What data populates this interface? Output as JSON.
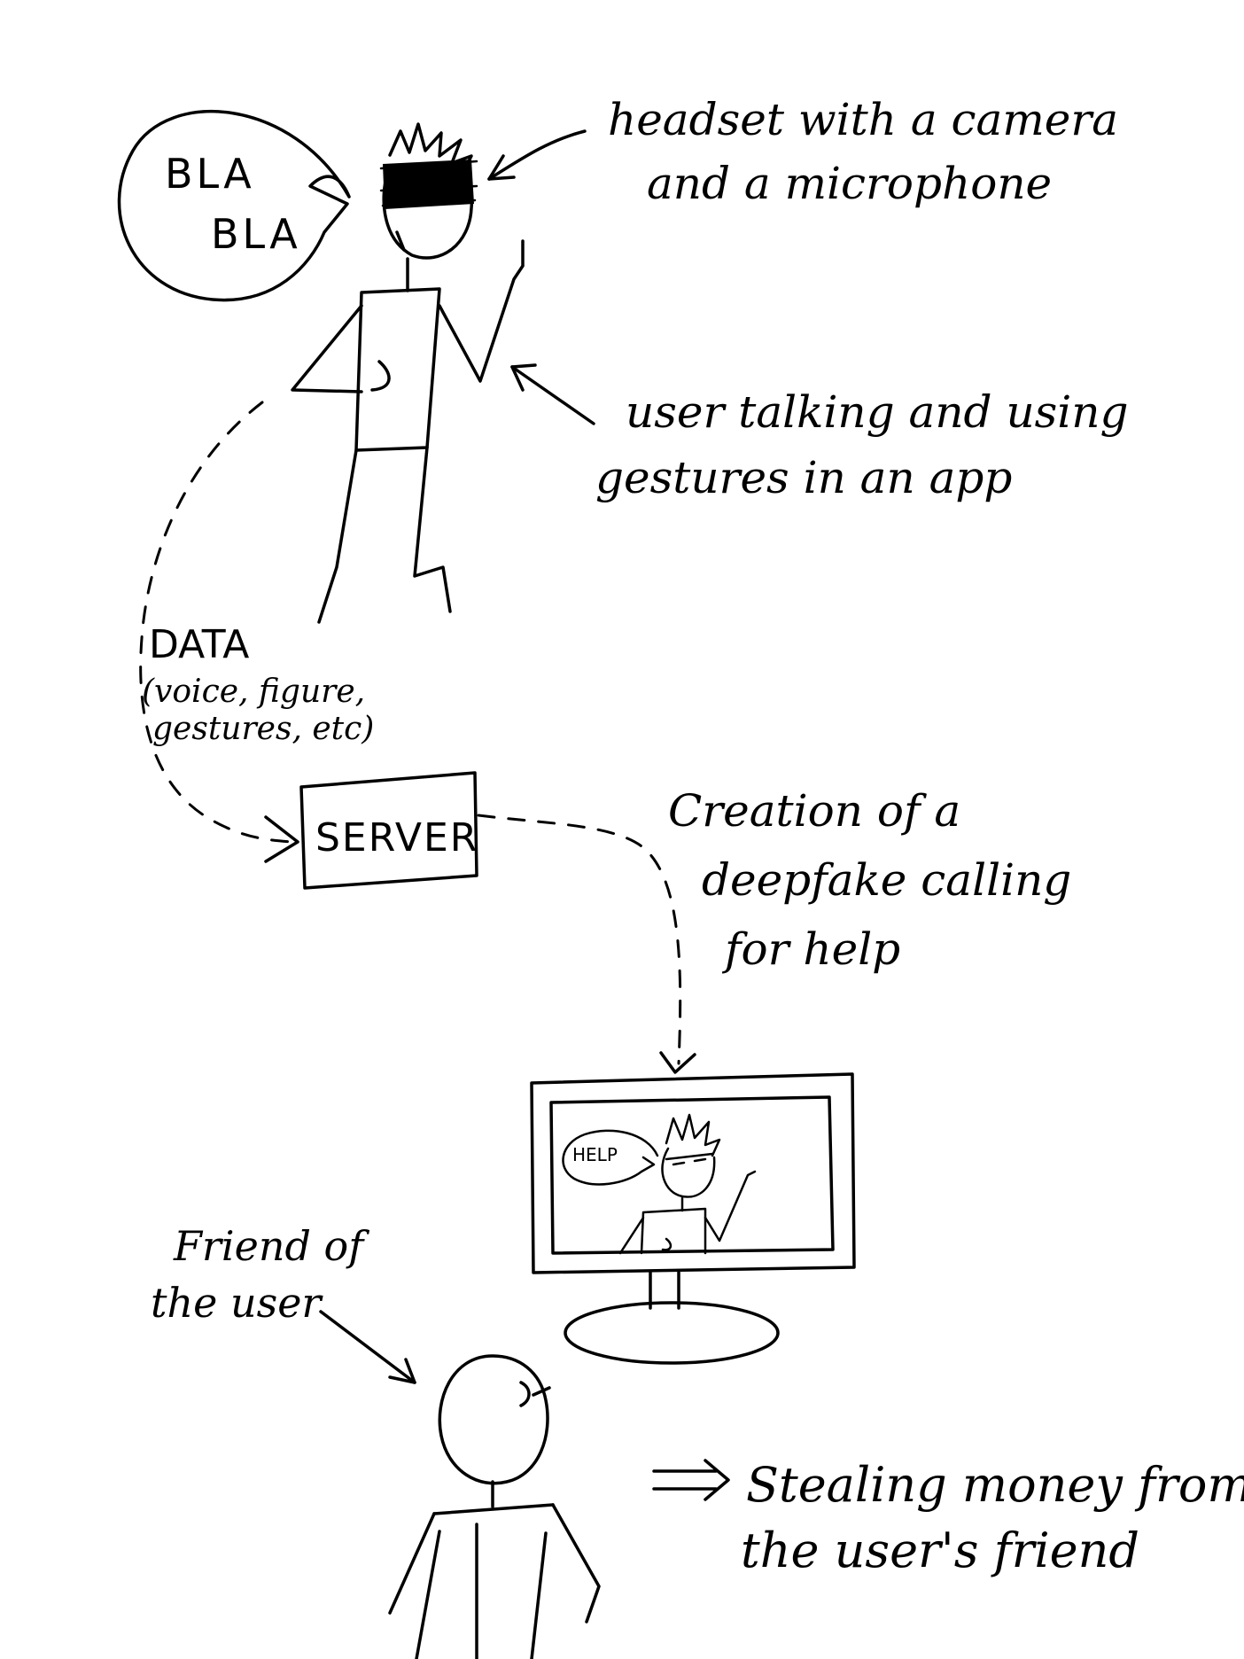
{
  "speech": {
    "line1": "BLA",
    "line2": "BLA"
  },
  "labels": {
    "headset_line1": "headset with a camera",
    "headset_line2": "and a microphone",
    "user_line1": "user talking and using",
    "user_line2": "gestures in an app",
    "data_title": "DATA",
    "data_line1": "(voice, figure,",
    "data_line2": "gestures, etc)",
    "server": "SERVER",
    "creation_line1": "Creation of a",
    "creation_line2": "deepfake calling",
    "creation_line3": "for help",
    "screen_speech": "HELP",
    "friend_line1": "Friend of",
    "friend_line2": "the user",
    "outcome_line1": "Stealing money from",
    "outcome_line2": "the user's friend"
  },
  "colors": {
    "ink": "#000000",
    "paper": "#ffffff"
  }
}
